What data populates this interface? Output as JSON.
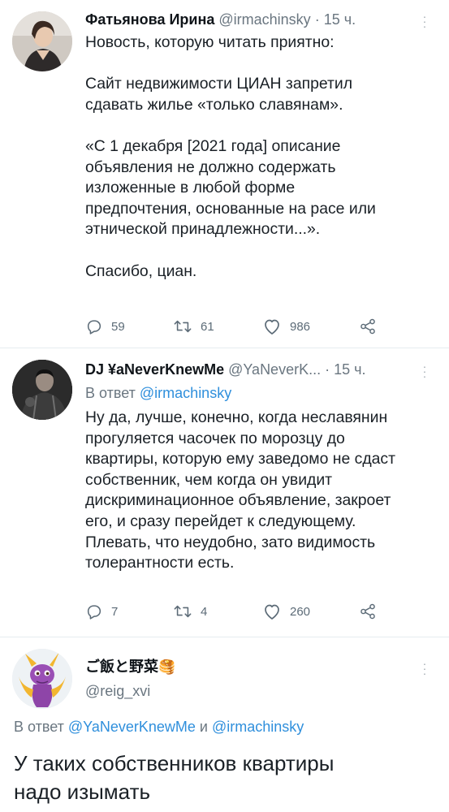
{
  "tweets": [
    {
      "author_name": "Фатьянова Ирина",
      "handle": "@irmachinsky",
      "time": "15 ч.",
      "text": "Новость, которую читать приятно:\n\nСайт недвижимости ЦИАН запретил\nсдавать жилье «только славянам».\n\n«С 1 декабря [2021 года] описание\nобъявления не должно содержать\nизложенные в любой форме\nпредпочтения, основанные на расе или\nэтнической принадлежности...».\n\nСпасибо, циан.",
      "replies": "59",
      "retweets": "61",
      "likes": "986"
    },
    {
      "author_name": "DJ ¥aNeverKnewMe",
      "handle": "@YaNeverK...",
      "time": "15 ч.",
      "reply_prefix": "В ответ",
      "reply_handle": "@irmachinsky",
      "text": "Ну да, лучше, конечно, когда неславянин\nпрогуляется часочек по морозцу до\nквартиры, которую ему заведомо не сдаст\nсобственник, чем когда он увидит\nдискриминационное объявление, закроет\nего, и сразу перейдет к следующему.\nПлевать, что неудобно, зато видимость\nтолерантности есть.",
      "replies": "7",
      "retweets": "4",
      "likes": "260"
    },
    {
      "author_name": "ご飯と野菜",
      "author_emoji": "🥞",
      "handle": "@reig_xvi",
      "reply_prefix": "В ответ",
      "reply_handle_1": "@YaNeverKnewMe",
      "reply_and": "и",
      "reply_handle_2": "@irmachinsky",
      "text": "У таких собственников квартиры\nнадо изымать"
    }
  ],
  "colors": {
    "link": "#2f8fdc",
    "secondary_text": "#6a7680",
    "icon": "#5c6b77"
  }
}
